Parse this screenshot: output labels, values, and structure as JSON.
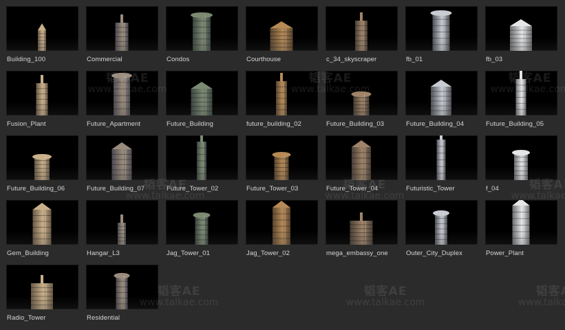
{
  "assets": [
    {
      "label": "Building_100",
      "icon": "building-100-thumbnail"
    },
    {
      "label": "Commercial",
      "icon": "commercial-thumbnail"
    },
    {
      "label": "Condos",
      "icon": "condos-thumbnail"
    },
    {
      "label": "Courthouse",
      "icon": "courthouse-thumbnail"
    },
    {
      "label": "c_34_skyscraper",
      "icon": "skyscraper-thumbnail"
    },
    {
      "label": "fb_01",
      "icon": "fb-01-thumbnail"
    },
    {
      "label": "fb_03",
      "icon": "fb-03-thumbnail"
    },
    {
      "label": "Fusion_Plant",
      "icon": "fusion-plant-thumbnail"
    },
    {
      "label": "Future_Apartment",
      "icon": "future-apartment-thumbnail"
    },
    {
      "label": "Future_Building",
      "icon": "future-building-thumbnail"
    },
    {
      "label": "future_building_02",
      "icon": "future-building-02-thumbnail"
    },
    {
      "label": "Future_Building_03",
      "icon": "future-building-03-thumbnail"
    },
    {
      "label": "Future_Building_04",
      "icon": "future-building-04-thumbnail"
    },
    {
      "label": "Future_Building_05",
      "icon": "future-building-05-thumbnail"
    },
    {
      "label": "Future_Building_06",
      "icon": "future-building-06-thumbnail"
    },
    {
      "label": "Future_Building_07",
      "icon": "future-building-07-thumbnail"
    },
    {
      "label": "Future_Tower_02",
      "icon": "future-tower-02-thumbnail"
    },
    {
      "label": "Future_Tower_03",
      "icon": "future-tower-03-thumbnail"
    },
    {
      "label": "Future_Tower_04",
      "icon": "future-tower-04-thumbnail"
    },
    {
      "label": "Futuristic_Tower",
      "icon": "futuristic-tower-thumbnail"
    },
    {
      "label": "f_04",
      "icon": "f-04-thumbnail"
    },
    {
      "label": "Gem_Building",
      "icon": "gem-building-thumbnail"
    },
    {
      "label": "Hangar_L3",
      "icon": "hangar-l3-thumbnail"
    },
    {
      "label": "Jag_Tower_01",
      "icon": "jag-tower-01-thumbnail"
    },
    {
      "label": "Jag_Tower_02",
      "icon": "jag-tower-02-thumbnail"
    },
    {
      "label": "mega_embassy_one",
      "icon": "mega-embassy-thumbnail"
    },
    {
      "label": "Outer_City_Duplex",
      "icon": "outer-city-duplex-thumbnail"
    },
    {
      "label": "Power_Plant",
      "icon": "power-plant-thumbnail"
    },
    {
      "label": "Radio_Tower",
      "icon": "radio-tower-thumbnail"
    },
    {
      "label": "Residential",
      "icon": "residential-thumbnail"
    }
  ],
  "watermark": {
    "brand": "韬客AE",
    "url": "www.talkae.com"
  },
  "colors": {
    "background": "#2b2b2b",
    "thumbnail": "#000000",
    "label": "#d6d6d6"
  }
}
